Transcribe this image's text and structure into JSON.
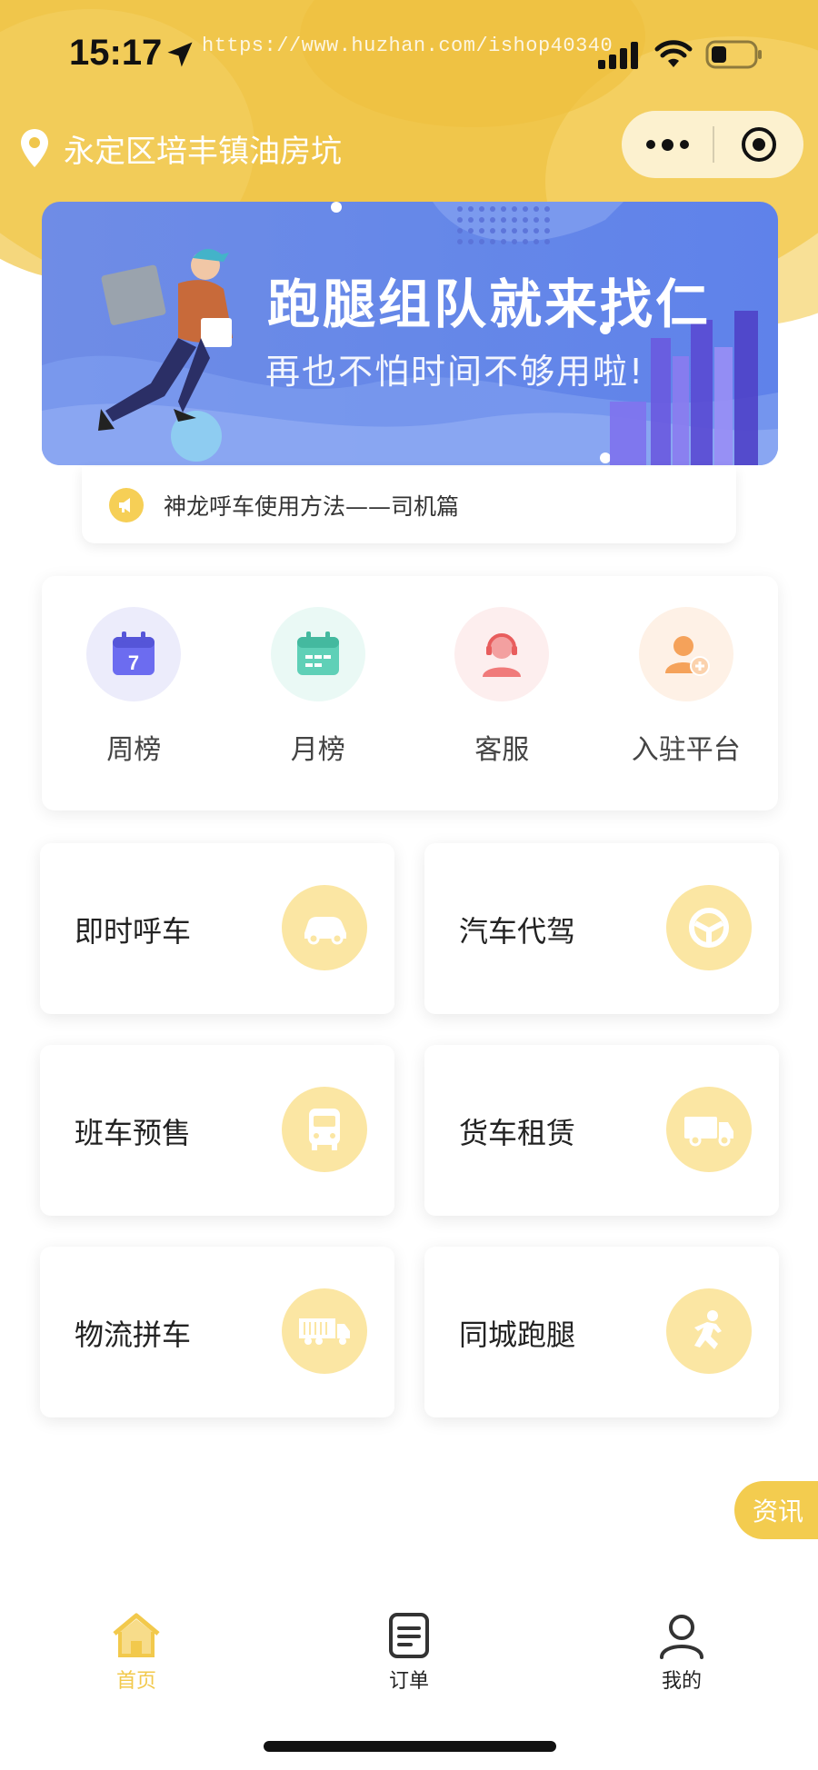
{
  "status_bar": {
    "time": "15:17",
    "watermark": "https://www.huzhan.com/ishop40340"
  },
  "location": {
    "text": "永定区培丰镇油房坑",
    "icon": "location-pin-icon"
  },
  "capsule": {
    "more_icon": "more-dots-icon",
    "close_icon": "target-close-icon"
  },
  "banner": {
    "title": "跑腿组队就来找仁",
    "subtitle": "再也不怕时间不够用啦!"
  },
  "notice": {
    "icon": "megaphone-icon",
    "text": "神龙呼车使用方法——司机篇"
  },
  "quick_nav": [
    {
      "label": "周榜",
      "icon": "calendar-7-icon",
      "color": "#6c6cf0"
    },
    {
      "label": "月榜",
      "icon": "calendar-grid-icon",
      "color": "#5fd0b7"
    },
    {
      "label": "客服",
      "icon": "customer-service-icon",
      "color": "#f07a7a"
    },
    {
      "label": "入驻平台",
      "icon": "user-add-icon",
      "color": "#f5a25a"
    }
  ],
  "services": [
    {
      "label": "即时呼车",
      "icon": "car-icon"
    },
    {
      "label": "汽车代驾",
      "icon": "steering-wheel-icon"
    },
    {
      "label": "班车预售",
      "icon": "bus-icon"
    },
    {
      "label": "货车租赁",
      "icon": "van-icon"
    },
    {
      "label": "物流拼车",
      "icon": "truck-icon"
    },
    {
      "label": "同城跑腿",
      "icon": "runner-icon"
    }
  ],
  "float_button": {
    "label": "资讯"
  },
  "tabs": [
    {
      "label": "首页",
      "icon": "home-icon",
      "active": true
    },
    {
      "label": "订单",
      "icon": "order-list-icon",
      "active": false
    },
    {
      "label": "我的",
      "icon": "profile-icon",
      "active": false
    }
  ],
  "colors": {
    "brand_yellow": "#f0c64b",
    "icon_circle": "#fbe6a3",
    "active_tab": "#f2c94c",
    "banner_blue": "#6688e8"
  }
}
